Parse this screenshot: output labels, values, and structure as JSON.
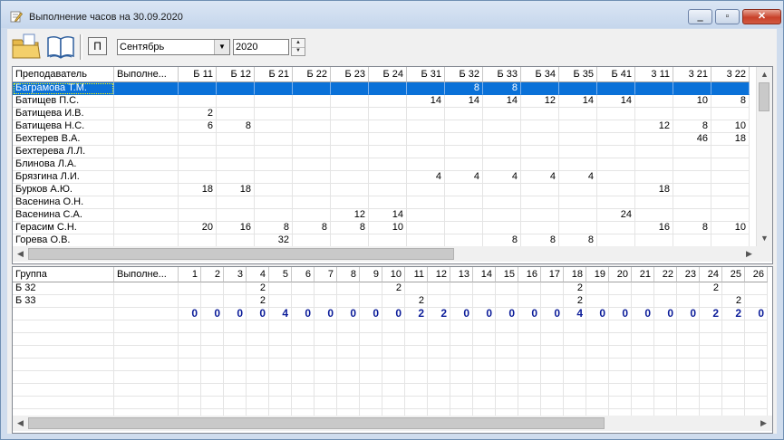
{
  "window": {
    "title": "Выполнение часов на 30.09.2020"
  },
  "toolbar": {
    "p_label": "П",
    "month": "Сентябрь",
    "month_options": [
      "Сентябрь"
    ],
    "year": "2020"
  },
  "teachers": {
    "headers": [
      "Преподаватель",
      "Выполне...",
      "Б 11",
      "Б 12",
      "Б 21",
      "Б 22",
      "Б 23",
      "Б 24",
      "Б 31",
      "Б 32",
      "Б 33",
      "Б 34",
      "Б 35",
      "Б 41",
      "3 11",
      "3 21",
      "3 22"
    ],
    "selected_row": 0,
    "rows": [
      [
        "Баграмова Т.М.",
        "",
        "",
        "",
        "",
        "",
        "",
        "",
        "",
        "8",
        "8",
        "",
        "",
        "",
        "",
        "",
        ""
      ],
      [
        "Батищев П.С.",
        "",
        "",
        "",
        "",
        "",
        "",
        "",
        "14",
        "14",
        "14",
        "12",
        "14",
        "14",
        "",
        "10",
        "8"
      ],
      [
        "Батищева И.В.",
        "",
        "2",
        "",
        "",
        "",
        "",
        "",
        "",
        "",
        "",
        "",
        "",
        "",
        "",
        "",
        ""
      ],
      [
        "Батищева Н.С.",
        "",
        "6",
        "8",
        "",
        "",
        "",
        "",
        "",
        "",
        "",
        "",
        "",
        "",
        "12",
        "8",
        "10"
      ],
      [
        "Бехтерев В.А.",
        "",
        "",
        "",
        "",
        "",
        "",
        "",
        "",
        "",
        "",
        "",
        "",
        "",
        "",
        "46",
        "18"
      ],
      [
        "Бехтерева Л.Л.",
        "",
        "",
        "",
        "",
        "",
        "",
        "",
        "",
        "",
        "",
        "",
        "",
        "",
        "",
        "",
        ""
      ],
      [
        "Блинова Л.А.",
        "",
        "",
        "",
        "",
        "",
        "",
        "",
        "",
        "",
        "",
        "",
        "",
        "",
        "",
        "",
        ""
      ],
      [
        "Брязгина Л.И.",
        "",
        "",
        "",
        "",
        "",
        "",
        "",
        "4",
        "4",
        "4",
        "4",
        "4",
        "",
        "",
        "",
        ""
      ],
      [
        "Бурков А.Ю.",
        "",
        "18",
        "18",
        "",
        "",
        "",
        "",
        "",
        "",
        "",
        "",
        "",
        "",
        "18",
        "",
        ""
      ],
      [
        "Васенина О.Н.",
        "",
        "",
        "",
        "",
        "",
        "",
        "",
        "",
        "",
        "",
        "",
        "",
        "",
        "",
        "",
        ""
      ],
      [
        "Васенина С.А.",
        "",
        "",
        "",
        "",
        "",
        "12",
        "14",
        "",
        "",
        "",
        "",
        "",
        "24",
        "",
        "",
        ""
      ],
      [
        "Герасим С.Н.",
        "",
        "20",
        "16",
        "8",
        "8",
        "8",
        "10",
        "",
        "",
        "",
        "",
        "",
        "",
        "16",
        "8",
        "10"
      ],
      [
        "Горева О.В.",
        "",
        "",
        "",
        "32",
        "",
        "",
        "",
        "",
        "",
        "8",
        "8",
        "8",
        "",
        "",
        "",
        ""
      ]
    ]
  },
  "groups": {
    "headers": [
      "Группа",
      "Выполне...",
      "1",
      "2",
      "3",
      "4",
      "5",
      "6",
      "7",
      "8",
      "9",
      "10",
      "11",
      "12",
      "13",
      "14",
      "15",
      "16",
      "17",
      "18",
      "19",
      "20",
      "21",
      "22",
      "23",
      "24",
      "25",
      "26"
    ],
    "rows": [
      [
        "Б 32",
        "",
        "",
        "",
        "",
        "2",
        "",
        "",
        "",
        "",
        "",
        "2",
        "",
        "",
        "",
        "",
        "",
        "",
        "",
        "2",
        "",
        "",
        "",
        "",
        "",
        "2",
        "",
        ""
      ],
      [
        "Б 33",
        "",
        "",
        "",
        "",
        "2",
        "",
        "",
        "",
        "",
        "",
        "",
        "2",
        "",
        "",
        "",
        "",
        "",
        "",
        "2",
        "",
        "",
        "",
        "",
        "",
        "",
        "2",
        ""
      ]
    ],
    "totals": [
      "",
      "",
      "0",
      "0",
      "0",
      "0",
      "4",
      "0",
      "0",
      "0",
      "0",
      "0",
      "2",
      "2",
      "0",
      "0",
      "0",
      "0",
      "0",
      "4",
      "0",
      "0",
      "0",
      "0",
      "0",
      "2",
      "2",
      "0"
    ]
  },
  "colors": {
    "selection": "#0a71d8",
    "totals": "#0b1c99",
    "title_bar": "#cfdced"
  },
  "icons": [
    "edit-icon",
    "minimize-icon",
    "maximize-icon",
    "close-icon",
    "open-folder-icon",
    "book-icon",
    "dropdown-arrow-icon",
    "spin-up-icon",
    "spin-down-icon",
    "scroll-up-icon",
    "scroll-down-icon",
    "scroll-left-icon",
    "scroll-right-icon"
  ]
}
